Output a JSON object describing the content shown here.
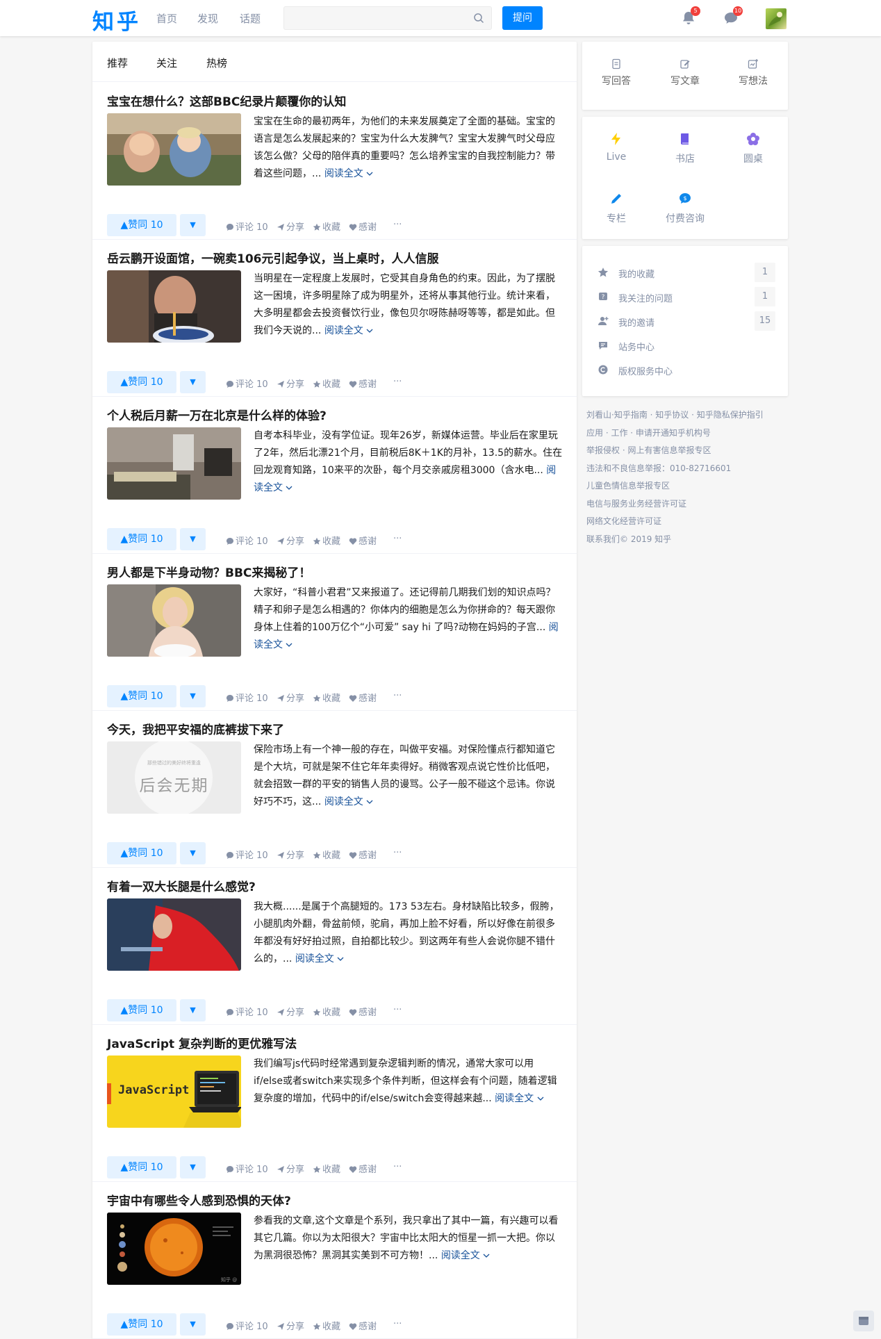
{
  "header": {
    "logo": "知乎",
    "nav": [
      "首页",
      "发现",
      "话题"
    ],
    "search_placeholder": "",
    "ask_label": "提问",
    "notifications_count": "5",
    "messages_count": "10"
  },
  "feed": {
    "tabs": [
      "推荐",
      "关注",
      "热榜"
    ],
    "read_more_label": "阅读全文",
    "actions": {
      "vote_up": "▲赞同 10",
      "comment": "评论 10",
      "share": "分享",
      "collect": "收藏",
      "thanks": "感谢",
      "more": "···"
    },
    "items": [
      {
        "title": "宝宝在想什么？这部BBC纪录片颠覆你的认知",
        "excerpt": "宝宝在生命的最初两年，为他们的未来发展奠定了全面的基础。宝宝的语言是怎么发展起来的？宝宝为什么大发脾气？宝宝大发脾气时父母应该怎么做？父母的陪伴真的重要吗？怎么培养宝宝的自我控制能力？带着这些问题，..."
      },
      {
        "title": "岳云鹏开设面馆，一碗卖106元引起争议，当上桌时，人人信服",
        "excerpt": "当明星在一定程度上发展时，它受其自身角色的约束。因此，为了摆脱这一困境，许多明星除了成为明星外，还将从事其他行业。统计来看，大多明星都会去投资餐饮行业，像包贝尔呀陈赫呀等等，都是如此。但我们今天说的..."
      },
      {
        "title": "个人税后月薪一万在北京是什么样的体验?",
        "excerpt": "自考本科毕业，没有学位证。现年26岁，新媒体运营。毕业后在家里玩了2年，然后北漂21个月，目前税后8K＋1K的月补，13.5的薪水。住在回龙观育知路，10来平的次卧，每个月交亲戚房租3000（含水电..."
      },
      {
        "title": "男人都是下半身动物？BBC来揭秘了！",
        "excerpt": "大家好，“科普小君君”又来报道了。还记得前几期我们划的知识点吗？精子和卵子是怎么相遇的？你体内的细胞是怎么为你拼命的？每天跟你身体上住着的100万亿个“小可爱” say hi 了吗?动物在妈妈的子宫..."
      },
      {
        "title": "今天，我把平安福的底裤拔下来了",
        "excerpt": "保险市场上有一个神一般的存在，叫做平安福。对保险懂点行都知道它是个大坑，可就是架不住它年年卖得好。稍微客观点说它性价比低吧，就会招致一群的平安的销售人员的谩骂。公子一般不碰这个忌讳。你说好巧不巧，这...",
        "thumb_title": "后会无期",
        "thumb_caption": "那些错过的美好终将重逢"
      },
      {
        "title": "有着一双大长腿是什么感觉?",
        "excerpt": "我大概......是属于个高腿短的。173 53左右。身材缺陷比较多，假胯，小腿肌肉外翻，骨盆前倾，驼肩，再加上脸不好看，所以好像在前很多年都没有好好拍过照，自拍都比较少。到这两年有些人会说你腿不错什么的，..."
      },
      {
        "title": "JavaScript 复杂判断的更优雅写法",
        "excerpt": "我们编写js代码时经常遇到复杂逻辑判断的情况，通常大家可以用if/else或者switch来实现多个条件判断，但这样会有个问题，随着逻辑复杂度的增加，代码中的if/else/switch会变得越来越...",
        "thumb_title": "JavaScript"
      },
      {
        "title": "宇宙中有哪些令人感到恐惧的天体?",
        "excerpt": "参看我的文章,这个文章是个系列，我只拿出了其中一篇，有兴趣可以看其它几篇。你以为太阳很大？宇宙中比太阳大的恒星一抓一大把。你以为黑洞很恐怖？黑洞其实美到不可方物！...",
        "thumb_caption": "知乎 @"
      }
    ]
  },
  "sidebar": {
    "write": [
      "写回答",
      "写文章",
      "写想法"
    ],
    "features": [
      "Live",
      "书店",
      "圆桌",
      "专栏",
      "付费咨询"
    ],
    "list": [
      {
        "label": "我的收藏",
        "count": "1"
      },
      {
        "label": "我关注的问题",
        "count": "1"
      },
      {
        "label": "我的邀请",
        "count": "15"
      },
      {
        "label": "站务中心",
        "count": ""
      },
      {
        "label": "版权服务中心",
        "count": ""
      }
    ],
    "footer": [
      "刘看山·知乎指南 · 知乎协议 · 知乎隐私保护指引",
      "应用 · 工作 · 申请开通知乎机构号",
      "举报侵权 · 网上有害信息举报专区",
      "违法和不良信息举报：010-82716601",
      "儿童色情信息举报专区",
      "电信与服务业务经营许可证",
      "网络文化经营许可证",
      "联系我们© 2019 知乎"
    ]
  },
  "colors": {
    "brand": "#0084ff",
    "muted": "#8590a6",
    "link": "#175199",
    "badge": "#f1403c"
  }
}
